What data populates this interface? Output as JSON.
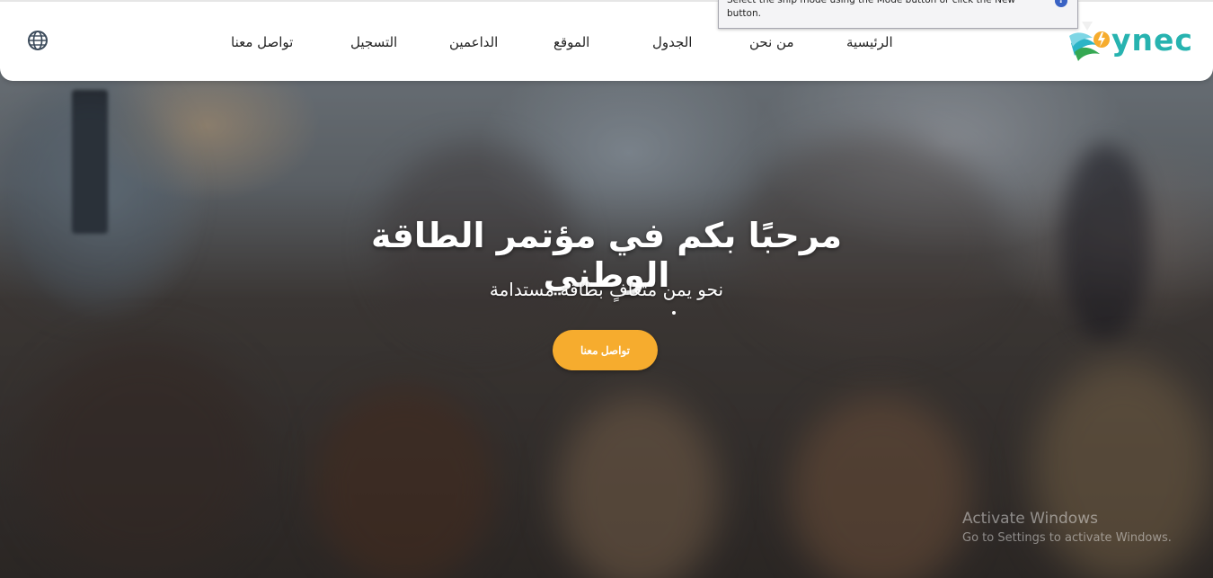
{
  "header": {
    "logo_text": "ynec",
    "nav": [
      {
        "label": "الرئيسية"
      },
      {
        "label": "من نحن"
      },
      {
        "label": "الجدول"
      },
      {
        "label": "الموقع"
      },
      {
        "label": "الداعمين"
      },
      {
        "label": "التسجيل"
      },
      {
        "label": "تواصل معنا"
      }
    ],
    "language_icon": "globe-icon"
  },
  "tooltip": {
    "text": "Select the snip mode using the Mode button or click the New button.",
    "help_icon": "help-icon"
  },
  "hero": {
    "title": "مرحبًا بكم في مؤتمر الطاقة الوطني",
    "subtitle": "نحو يمن متعافٍ بطاقة مستدامة",
    "cta_label": "تواصل معنا"
  },
  "watermark": {
    "title": "Activate Windows",
    "subtitle": "Go to Settings to activate Windows."
  },
  "colors": {
    "accent": "#f6ac2e",
    "brand_teal": "#27b3b0",
    "nav_text": "#222222"
  }
}
